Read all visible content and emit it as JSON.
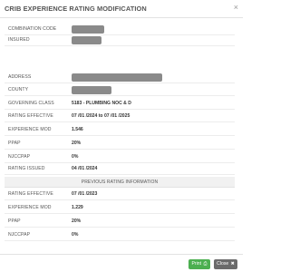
{
  "modal": {
    "title": "CRIB EXPERIENCE RATING MODIFICATION",
    "close_icon": "×"
  },
  "fields": [
    {
      "label": "COMBINATION CODE",
      "value": null,
      "redacted": true
    },
    {
      "label": "INSURED",
      "value": null,
      "redacted": true
    },
    {
      "label": "ADDRESS",
      "value": null,
      "redacted": true
    },
    {
      "label": "COUNTY",
      "value": null,
      "redacted": true
    },
    {
      "label": "GOVERNING CLASS",
      "value": "5183 - PLUMBING NOC & D"
    },
    {
      "label": "RATING EFFECTIVE",
      "value": "07 /01 /2024 to 07 /01 /2025"
    },
    {
      "label": "EXPERIENCE MOD",
      "value": "1.546"
    },
    {
      "label": "PPAP",
      "value": "20%"
    },
    {
      "label": "NJCCPAP",
      "value": "0%"
    },
    {
      "label": "RATING ISSUED",
      "value": "04 /01 /2024"
    }
  ],
  "previous": {
    "section_label": "PREVIOUS RATING INFORMATION",
    "fields": [
      {
        "label": "RATING EFFECTIVE",
        "value": "07 /01 /2023"
      },
      {
        "label": "EXPERIENCE MOD",
        "value": "1.229"
      },
      {
        "label": "PPAP",
        "value": "20%"
      },
      {
        "label": "NJCCPAP",
        "value": "0%"
      }
    ]
  },
  "footer": {
    "print_label": "Print",
    "print_icon": "printer-icon",
    "close_label": "Close",
    "close_icon": "close-icon"
  },
  "colors": {
    "print_button": "#4caf50",
    "close_button": "#6b6b6b",
    "redaction": "#8a8a8a"
  }
}
